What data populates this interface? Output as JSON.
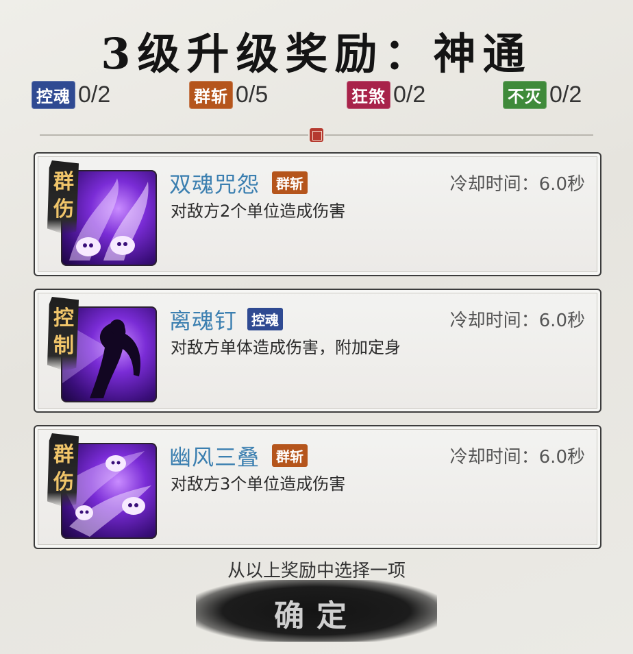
{
  "title": "3级升级奖励：神通",
  "counters": [
    {
      "tag": "控魂",
      "value": "0/2",
      "color": "#2f4a92"
    },
    {
      "tag": "群斩",
      "value": "0/5",
      "color": "#b5551c"
    },
    {
      "tag": "狂煞",
      "value": "0/2",
      "color": "#a8234a"
    },
    {
      "tag": "不灭",
      "value": "0/2",
      "color": "#3f8a3a"
    }
  ],
  "skills": [
    {
      "ribbon": "群伤",
      "name": "双魂咒怨",
      "tag": "群斩",
      "tag_color": "#b5551c",
      "cooldown": "冷却时间：6.0秒",
      "description": "对敌方2个单位造成伤害",
      "icon": "twin-ghost-icon"
    },
    {
      "ribbon": "控制",
      "name": "离魂钉",
      "tag": "控魂",
      "tag_color": "#2f4a92",
      "cooldown": "冷却时间：6.0秒",
      "description": "对敌方单体造成伤害，附加定身",
      "icon": "soul-pin-icon"
    },
    {
      "ribbon": "群伤",
      "name": "幽风三叠",
      "tag": "群斩",
      "tag_color": "#b5551c",
      "cooldown": "冷却时间：6.0秒",
      "description": "对敌方3个单位造成伤害",
      "icon": "ghost-wind-icon"
    }
  ],
  "hint": "从以上奖励中选择一项",
  "confirm_label": "确定",
  "colors": {
    "skill_name": "#3b7fb0",
    "ribbon_text": "#f0c56a",
    "card_border": "#3c3c3c"
  }
}
